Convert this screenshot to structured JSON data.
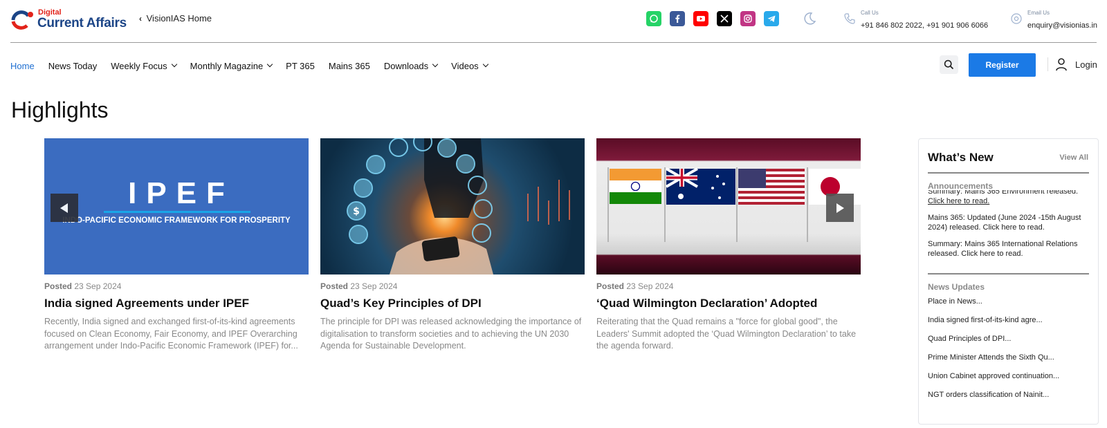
{
  "logo": {
    "digital": "Digital",
    "brand": "Current Affairs"
  },
  "top_link": "VisionIAS Home",
  "socials": [
    {
      "name": "whatsapp-icon",
      "color": "#25d366"
    },
    {
      "name": "facebook-icon",
      "color": "#3b5998"
    },
    {
      "name": "youtube-icon",
      "color": "#ff0000"
    },
    {
      "name": "x-icon",
      "color": "#000000"
    },
    {
      "name": "instagram-icon",
      "color": "#c13584"
    },
    {
      "name": "telegram-icon",
      "color": "#29a9eb"
    }
  ],
  "contact": {
    "call_label": "Call Us",
    "call_value": "+91 846 802 2022, +91 901 906 6066",
    "email_label": "Email Us",
    "email_value": "enquiry@visionias.in"
  },
  "nav": {
    "items": [
      {
        "label": "Home",
        "dropdown": false,
        "active": true
      },
      {
        "label": "News Today",
        "dropdown": false,
        "active": false
      },
      {
        "label": "Weekly Focus",
        "dropdown": true,
        "active": false
      },
      {
        "label": "Monthly Magazine",
        "dropdown": true,
        "active": false
      },
      {
        "label": "PT 365",
        "dropdown": false,
        "active": false
      },
      {
        "label": "Mains 365",
        "dropdown": false,
        "active": false
      },
      {
        "label": "Downloads",
        "dropdown": true,
        "active": false
      },
      {
        "label": "Videos",
        "dropdown": true,
        "active": false
      }
    ],
    "register_label": "Register",
    "login_label": "Login"
  },
  "highlights": {
    "title": "Highlights",
    "cards": [
      {
        "posted_label": "Posted",
        "date": "23 Sep 2024",
        "title": "India signed Agreements under IPEF",
        "description": "Recently, India signed and exchanged first-of-its-kind agreements focused on Clean Economy, Fair Economy, and IPEF Overarching arrangement under Indo-Pacific Economic Framework (IPEF) for...",
        "image_text": "IPEF",
        "image_subtext": "INDO-PACIFIC ECONOMIC FRAMEWORK FOR PROSPERITY"
      },
      {
        "posted_label": "Posted",
        "date": "23 Sep 2024",
        "title": "Quad’s Key Principles of DPI",
        "description": "The principle for DPI was released acknowledging the importance of digitalisation to transform societies and to achieving the UN 2030 Agenda for Sustainable Development."
      },
      {
        "posted_label": "Posted",
        "date": "23 Sep 2024",
        "title": "‘Quad Wilmington Declaration’ Adopted",
        "description": "Reiterating that the Quad remains a \"force for global good\", the Leaders' Summit adopted the ‘Quad Wilmington Declaration’ to take the agenda forward."
      }
    ]
  },
  "whats_new": {
    "title": "What’s New",
    "view_all": "View All",
    "announcements_title": "Announcements",
    "announcements": [
      {
        "text": "Summary: Mains 365 Environment released.",
        "link": "Click here to read."
      },
      {
        "text": "Mains 365: Updated (June 2024 -15th August 2024) released. Click here to read.",
        "link": ""
      },
      {
        "text": "Summary: Mains 365 International Relations released. Click here to read.",
        "link": ""
      }
    ],
    "updates_title": "News Updates",
    "updates": [
      "Place in News...",
      "India signed first-of-its-kind agre...",
      "Quad Principles of DPI...",
      "Prime Minister Attends the Sixth Qu...",
      "Union Cabinet approved continuation...",
      "NGT orders classification of Nainit..."
    ]
  }
}
